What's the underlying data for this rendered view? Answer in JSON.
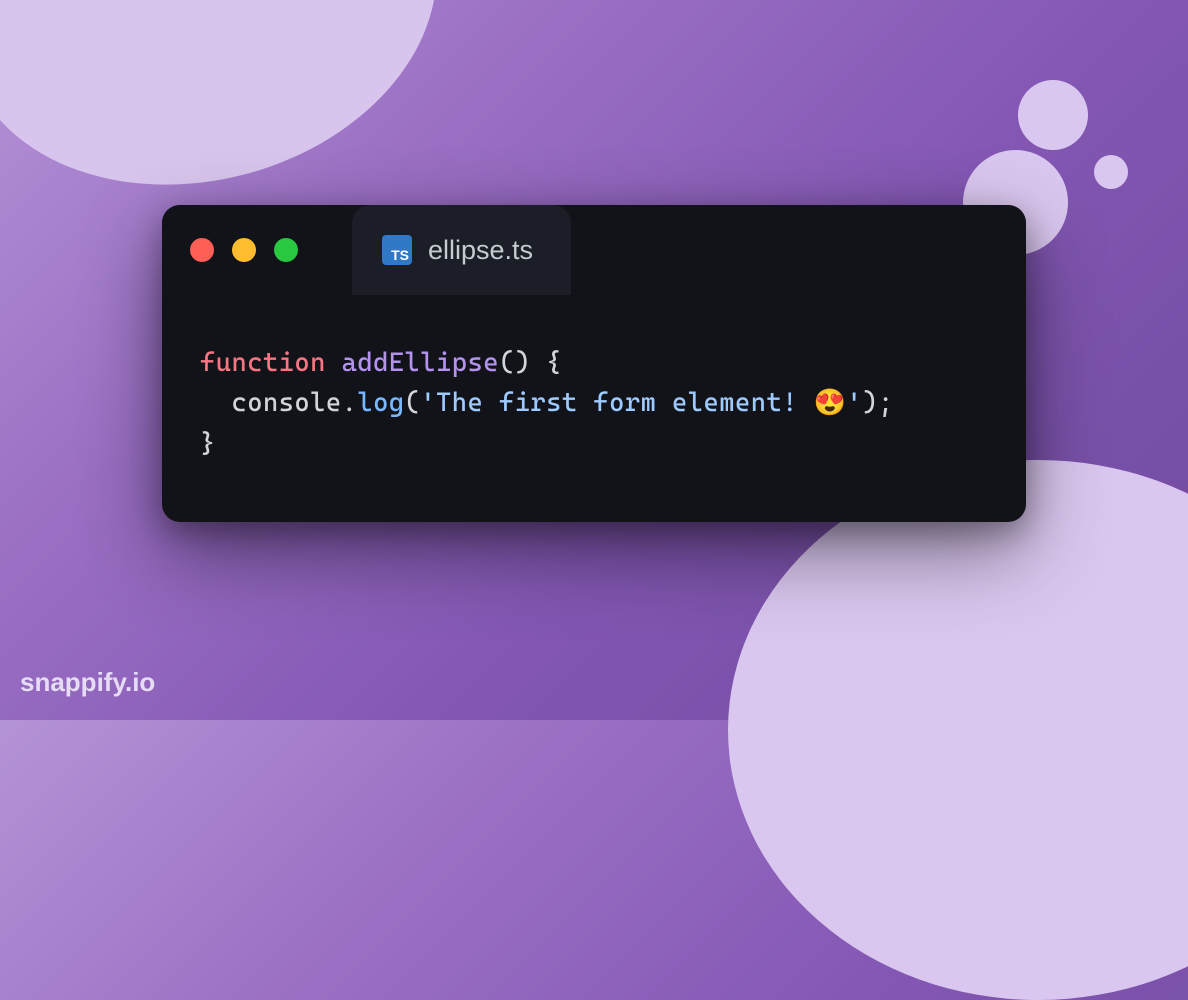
{
  "window": {
    "tab": {
      "icon_label": "TS",
      "filename": "ellipse.ts"
    }
  },
  "code": {
    "line1": {
      "keyword": "function",
      "space1": " ",
      "func_name": "addEllipse",
      "parens_brace": "() {"
    },
    "line2": {
      "indent": "  ",
      "obj": "console",
      "dot": ".",
      "method": "log",
      "open": "(",
      "string": "'The first form element! 😍'",
      "close": ");"
    },
    "line3": {
      "brace": "}"
    }
  },
  "watermark": "snappify.io"
}
